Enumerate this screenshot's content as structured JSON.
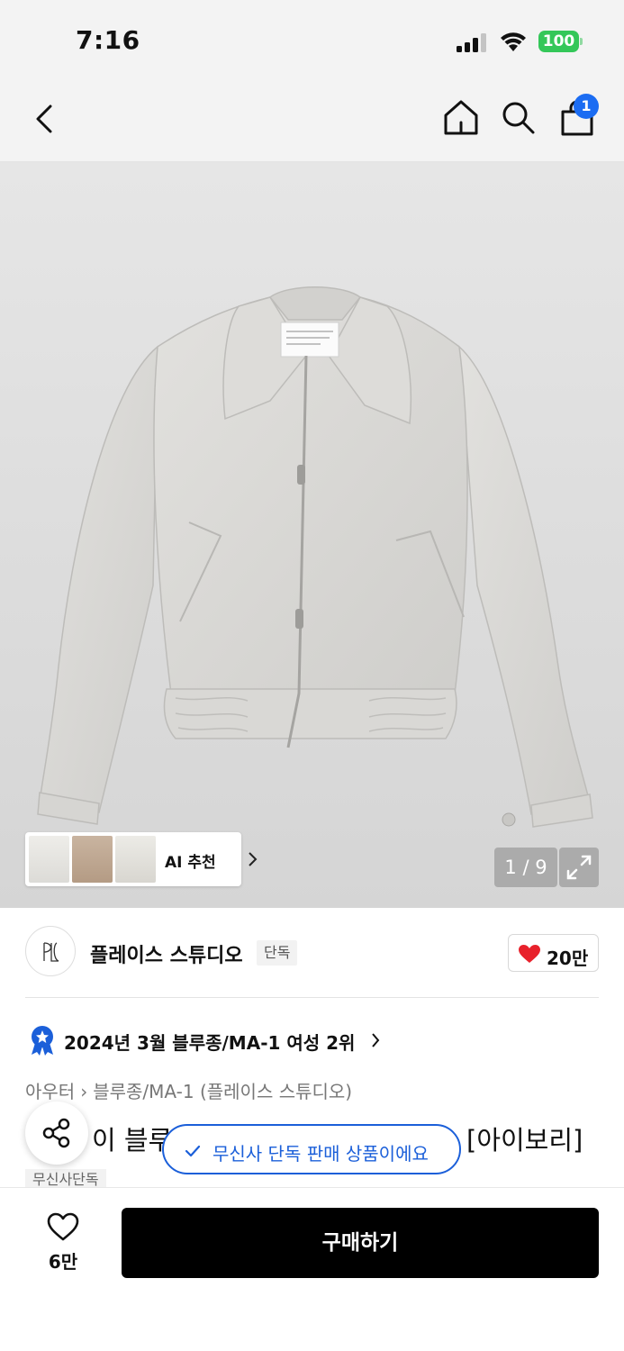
{
  "status_bar": {
    "time": "7:16",
    "battery": "100"
  },
  "nav": {
    "cart_count": "1"
  },
  "gallery": {
    "counter": "1 / 9",
    "ai_recommend_label": "AI 추천"
  },
  "brand": {
    "logo_text": "PLACE STUDIO",
    "name": "플레이스 스튜디오",
    "tag": "단독",
    "like_count": "20만"
  },
  "ranking": {
    "text": "2024년 3월 블루종/MA-1 여성 2위"
  },
  "breadcrumb": {
    "category": "아우터",
    "subcategory": "블루종/MA-1 (플레이스 스튜디오)"
  },
  "product": {
    "title_visible_left": "이 블루종",
    "title_visible_right": "[아이보리]",
    "exclusive_tag": "무신사단독"
  },
  "toast": {
    "text": "무신사 단독 판매 상품이에요"
  },
  "bottom": {
    "wish_count": "6만",
    "buy_label": "구매하기"
  },
  "colors": {
    "accent_blue": "#1b5fd9",
    "like_red": "#e8212b",
    "battery_green": "#34c759"
  }
}
